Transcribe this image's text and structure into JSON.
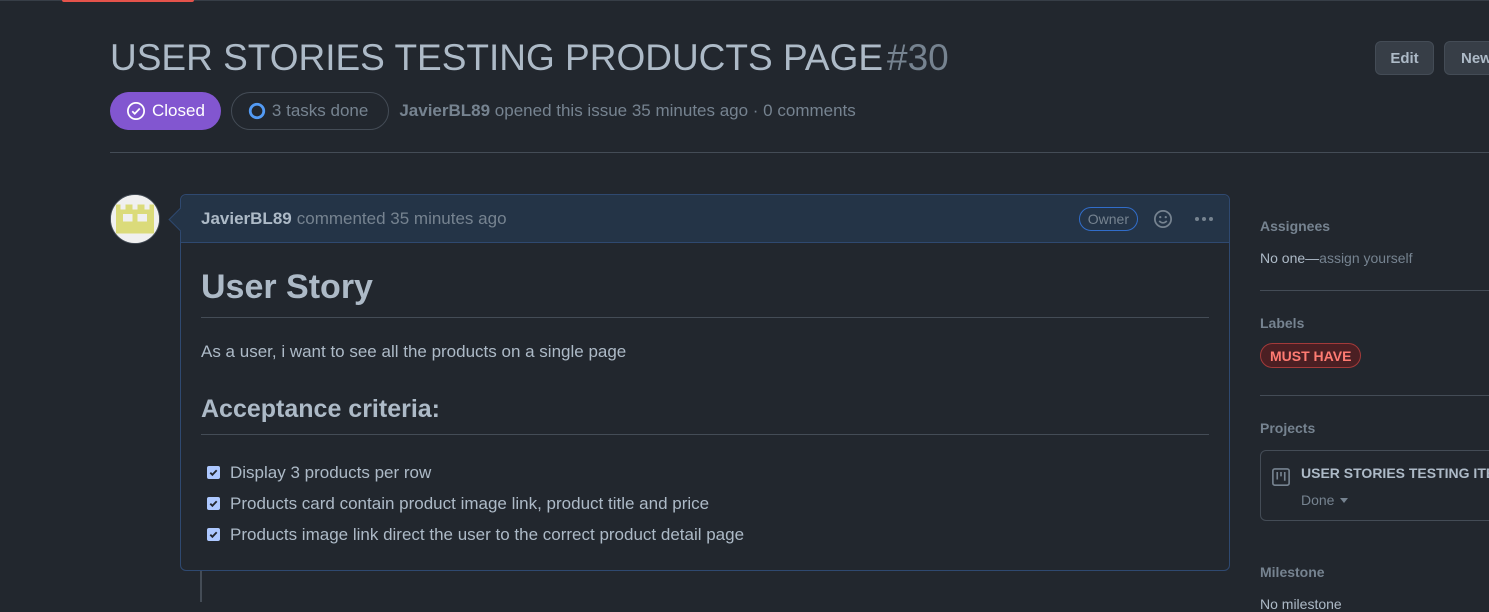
{
  "issue": {
    "title": "USER STORIES TESTING PRODUCTS PAGE",
    "number": "#30",
    "state": "Closed",
    "tasks": "3 tasks done",
    "author": "JavierBL89",
    "opened_text": "opened this issue 35 minutes ago · 0 comments"
  },
  "header_buttons": {
    "edit": "Edit",
    "new": "New"
  },
  "comment": {
    "author": "JavierBL89",
    "meta": "commented 35 minutes ago",
    "role_badge": "Owner",
    "heading": "User Story",
    "story": "As a user, i want to see all the products on a single page",
    "criteria_heading": "Acceptance criteria:",
    "tasks": [
      {
        "text": "Display 3 products per row",
        "checked": true
      },
      {
        "text": "Products card contain product image link, product title and price",
        "checked": true
      },
      {
        "text": "Products image link direct the user to the correct product detail page",
        "checked": true
      }
    ]
  },
  "sidebar": {
    "assignees": {
      "heading": "Assignees",
      "value": "No one—",
      "link": "assign yourself"
    },
    "labels": {
      "heading": "Labels",
      "items": [
        "MUST HAVE"
      ]
    },
    "projects": {
      "heading": "Projects",
      "name": "USER STORIES TESTING ITERATION",
      "status": "Done"
    },
    "milestone": {
      "heading": "Milestone",
      "value": "No milestone"
    }
  },
  "colors": {
    "closed_badge": "#8256d0",
    "label_must_have": "#ff7b72",
    "background": "#22272e"
  }
}
